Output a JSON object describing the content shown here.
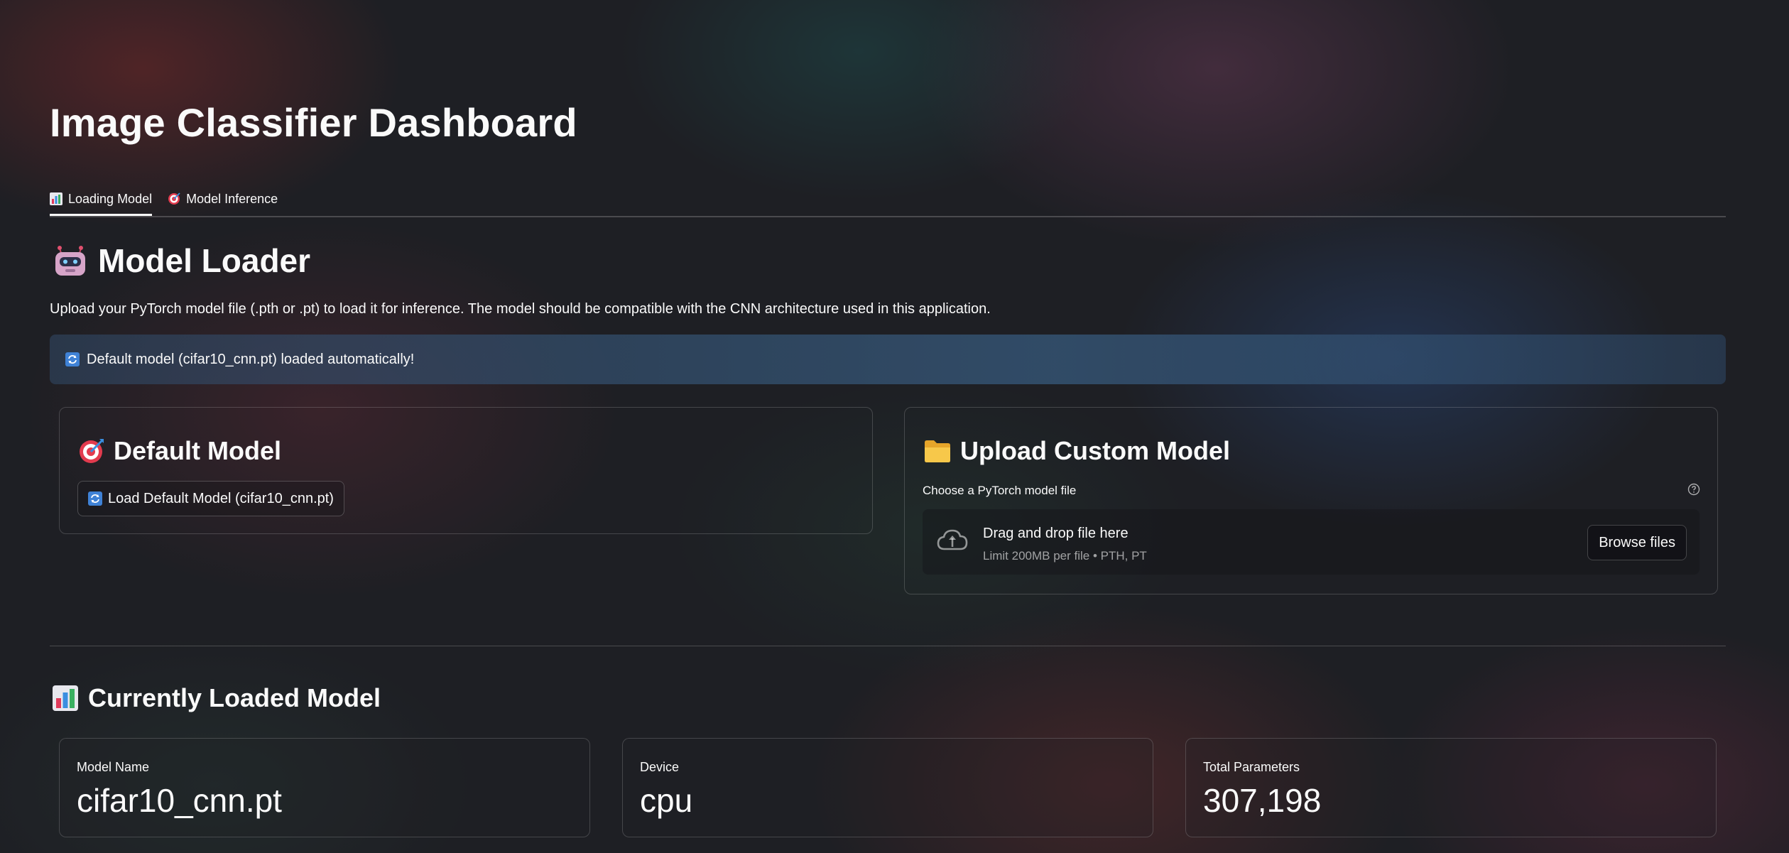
{
  "page": {
    "title": "Image Classifier Dashboard"
  },
  "tabs": [
    {
      "label": "Loading Model",
      "icon": "bar-chart-icon",
      "active": true
    },
    {
      "label": "Model Inference",
      "icon": "target-icon",
      "active": false
    }
  ],
  "loader": {
    "heading": "Model Loader",
    "heading_icon": "robot-icon",
    "description": "Upload your PyTorch model file (.pth or .pt) to load it for inference. The model should be compatible with the CNN architecture used in this application.",
    "info_banner": "Default model (cifar10_cnn.pt) loaded automatically!",
    "info_icon": "refresh-icon"
  },
  "default_model": {
    "title": "Default Model",
    "title_icon": "target-icon",
    "button_label": "Load Default Model (cifar10_cnn.pt)",
    "button_icon": "refresh-icon"
  },
  "upload_model": {
    "title": "Upload Custom Model",
    "title_icon": "folder-icon",
    "field_label": "Choose a PyTorch model file",
    "dropzone_title": "Drag and drop file here",
    "dropzone_subtitle": "Limit 200MB per file • PTH, PT",
    "browse_label": "Browse files"
  },
  "current_model": {
    "heading": "Currently Loaded Model",
    "heading_icon": "bar-chart-icon",
    "metrics": [
      {
        "label": "Model Name",
        "value": "cifar10_cnn.pt"
      },
      {
        "label": "Device",
        "value": "cpu"
      },
      {
        "label": "Total Parameters",
        "value": "307,198"
      }
    ]
  }
}
